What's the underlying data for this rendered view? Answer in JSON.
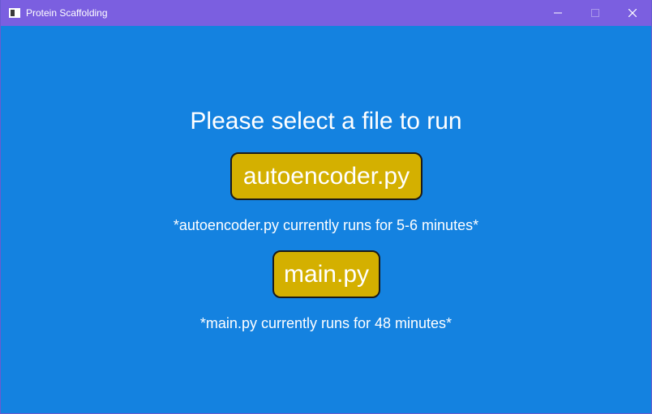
{
  "window": {
    "title": "Protein Scaffolding",
    "background_color": "#1482e0",
    "titlebar_color": "#7b5fe0"
  },
  "controls": {
    "minimize_icon": "minimize-icon",
    "maximize_icon": "maximize-icon",
    "close_icon": "close-icon"
  },
  "main": {
    "heading": "Please select a file to run",
    "buttons": [
      {
        "label": "autoencoder.py",
        "note": "*autoencoder.py currently runs for 5-6 minutes*"
      },
      {
        "label": "main.py",
        "note": "*main.py currently runs for 48 minutes*"
      }
    ],
    "button_color": "#d4b000"
  }
}
